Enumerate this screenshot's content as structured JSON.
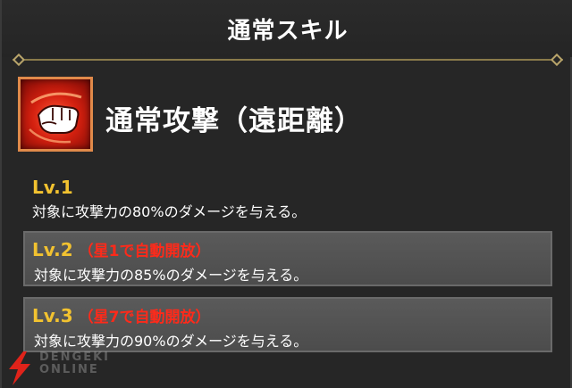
{
  "header": {
    "title": "通常スキル"
  },
  "skill": {
    "name": "通常攻撃（遠距離）",
    "icon": "fist-icon"
  },
  "levels": [
    {
      "label": "Lv.1",
      "unlock": "",
      "description": "対象に攻撃力の80%のダメージを与える。"
    },
    {
      "label": "Lv.2",
      "unlock": "（星1で自動開放）",
      "description": "対象に攻撃力の85%のダメージを与える。"
    },
    {
      "label": "Lv.3",
      "unlock": "（星7で自動開放）",
      "description": "対象に攻撃力の90%のダメージを与える。"
    }
  ],
  "watermark": {
    "line1": "DENGEKI",
    "line2": "ONLINE"
  },
  "colors": {
    "level_label": "#f2c230",
    "unlock_text": "#ff2a1a",
    "icon_frame": "#e08a4a",
    "icon_bg": "#d3200f"
  }
}
